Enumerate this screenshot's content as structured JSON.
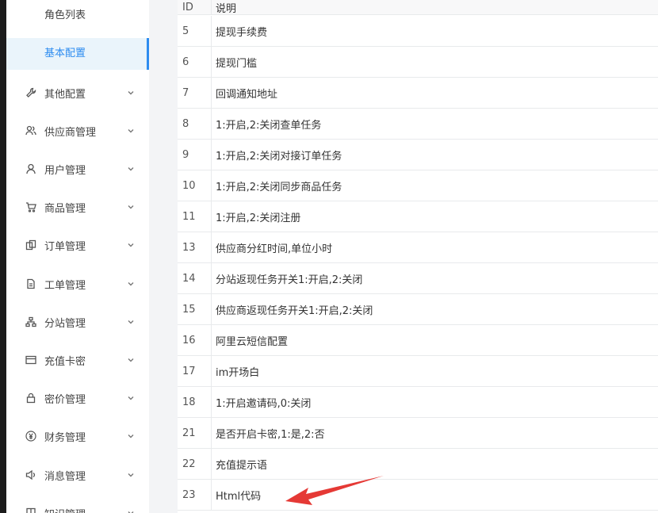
{
  "sidebar": {
    "sub_items": [
      {
        "label": "角色列表",
        "active": false
      },
      {
        "label": "基本配置",
        "active": true
      }
    ],
    "items": [
      {
        "label": "其他配置",
        "icon": "wrench-icon"
      },
      {
        "label": "供应商管理",
        "icon": "users-icon"
      },
      {
        "label": "用户管理",
        "icon": "user-icon"
      },
      {
        "label": "商品管理",
        "icon": "cart-icon"
      },
      {
        "label": "订单管理",
        "icon": "order-icon"
      },
      {
        "label": "工单管理",
        "icon": "document-icon"
      },
      {
        "label": "分站管理",
        "icon": "sitemap-icon"
      },
      {
        "label": "充值卡密",
        "icon": "card-icon"
      },
      {
        "label": "密价管理",
        "icon": "lock-icon"
      },
      {
        "label": "财务管理",
        "icon": "yen-icon"
      },
      {
        "label": "消息管理",
        "icon": "speaker-icon"
      },
      {
        "label": "知识管理",
        "icon": "book-icon"
      }
    ]
  },
  "table": {
    "columns": [
      "ID",
      "说明"
    ],
    "rows": [
      {
        "id": "5",
        "desc": "提现手续费"
      },
      {
        "id": "6",
        "desc": "提现门槛"
      },
      {
        "id": "7",
        "desc": "回调通知地址"
      },
      {
        "id": "8",
        "desc": "1:开启,2:关闭查单任务"
      },
      {
        "id": "9",
        "desc": "1:开启,2:关闭对接订单任务"
      },
      {
        "id": "10",
        "desc": "1:开启,2:关闭同步商品任务"
      },
      {
        "id": "11",
        "desc": "1:开启,2:关闭注册"
      },
      {
        "id": "13",
        "desc": "供应商分红时间,单位小时"
      },
      {
        "id": "14",
        "desc": "分站返现任务开关1:开启,2:关闭"
      },
      {
        "id": "15",
        "desc": "供应商返现任务开关1:开启,2:关闭"
      },
      {
        "id": "16",
        "desc": "阿里云短信配置"
      },
      {
        "id": "17",
        "desc": "im开场白"
      },
      {
        "id": "18",
        "desc": "1:开启邀请码,0:关闭"
      },
      {
        "id": "21",
        "desc": "是否开启卡密,1:是,2:否"
      },
      {
        "id": "22",
        "desc": "充值提示语"
      },
      {
        "id": "23",
        "desc": "Html代码"
      }
    ]
  },
  "colors": {
    "accent": "#2d8cf0",
    "active_bg": "#eaf4fb",
    "arrow": "#e53935"
  }
}
